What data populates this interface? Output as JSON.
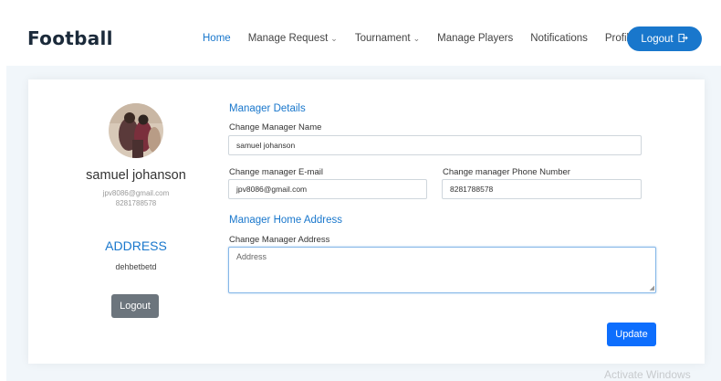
{
  "header": {
    "brand": "Football",
    "nav": [
      {
        "label": "Home",
        "active": true,
        "dropdown": false
      },
      {
        "label": "Manage Request",
        "active": false,
        "dropdown": true
      },
      {
        "label": "Tournament",
        "active": false,
        "dropdown": true
      },
      {
        "label": "Manage Players",
        "active": false,
        "dropdown": false
      },
      {
        "label": "Notifications",
        "active": false,
        "dropdown": false
      },
      {
        "label": "Profile",
        "active": false,
        "dropdown": false
      }
    ],
    "logout_label": "Logout",
    "logout_icon": "logout-icon"
  },
  "profile": {
    "name": "samuel johanson",
    "email": "jpv8086@gmail.com",
    "phone": "8281788578",
    "address_title": "ADDRESS",
    "address_value": "dehbetbetd",
    "logout_label": "Logout"
  },
  "form": {
    "manager_details_title": "Manager Details",
    "name_label": "Change Manager Name",
    "name_value": "samuel johanson",
    "email_label": "Change manager E-mail",
    "email_value": "jpv8086@gmail.com",
    "phone_label": "Change manager Phone Number",
    "phone_value": "8281788578",
    "home_address_title": "Manager Home Address",
    "address_label": "Change Manager Address",
    "address_placeholder": "Address",
    "update_label": "Update"
  },
  "watermark": "Activate Windows",
  "colors": {
    "accent": "#1977cc",
    "update_button": "#0d6efd",
    "secondary_button": "#6c757d",
    "band_bg": "#f1f6fa"
  }
}
